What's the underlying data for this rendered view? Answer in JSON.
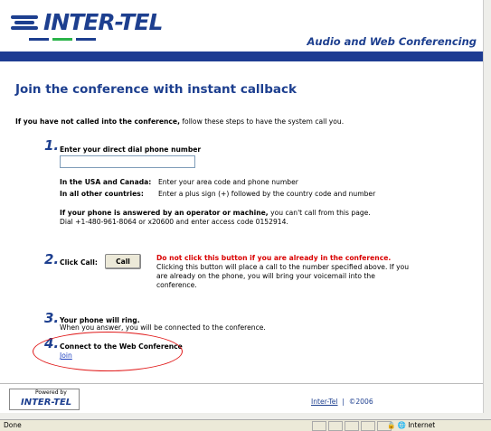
{
  "header": {
    "logo_text": "INTER-TEL",
    "tagline": "Audio and Web Conferencing"
  },
  "main": {
    "title": "Join the conference with instant callback",
    "intro_bold": "If you have not called into the conference,",
    "intro_rest": " follow these steps to have the system call you.",
    "step1": {
      "number": "1.",
      "label": "Enter your direct dial phone number",
      "phone_value": "",
      "usa_label": "In the USA and Canada:",
      "usa_text": "Enter your area code and phone number",
      "other_label": "In all other countries:",
      "other_text": "Enter a plus sign (+) followed by the country code and number",
      "note_bold": "If your phone is answered by an operator or machine,",
      "note_rest": " you can't call from this page.",
      "note_line2": "Dial +1-480-961-8064 or x20600 and enter access code 0152914."
    },
    "step2": {
      "number": "2.",
      "label": "Click Call:",
      "button": "Call",
      "warning": "Do not click this button if you are already in the conference.",
      "desc1": "Clicking this button will place a call to the number specified above. If you",
      "desc2": "are already on the phone, you will bring your voicemail into the",
      "desc3": "conference."
    },
    "step3": {
      "number": "3.",
      "label": "Your phone will ring.",
      "desc": "When you answer, you will be connected to the conference."
    },
    "step4": {
      "number": "4.",
      "label": "Connect to the Web Conference",
      "link": "Join"
    }
  },
  "footer": {
    "powered_label": "Powered by",
    "powered_name": "INTER-TEL",
    "link": "Inter-Tel",
    "separator": "|",
    "copyright": "©2006"
  },
  "statusbar": {
    "status": "Done",
    "zone": "Internet"
  },
  "colors": {
    "brand_blue": "#1d3f8f",
    "banner_blue": "#1e3c92",
    "warning_red": "#d90000",
    "annotation_red": "#e01818"
  }
}
